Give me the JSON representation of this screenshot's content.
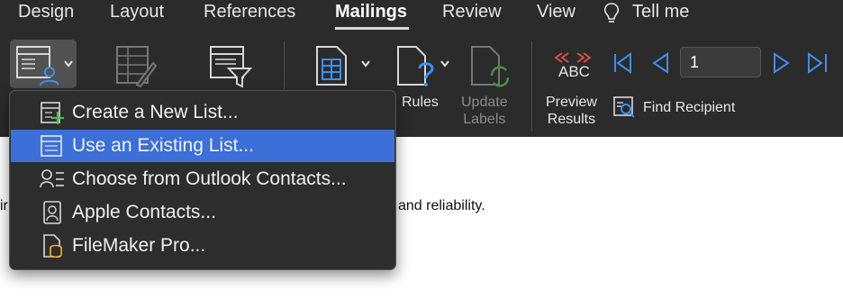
{
  "ribbon_tabs": [
    {
      "label": "Design"
    },
    {
      "label": "Layout"
    },
    {
      "label": "References"
    },
    {
      "label": "Mailings",
      "active": true
    },
    {
      "label": "Review"
    },
    {
      "label": "View"
    }
  ],
  "tell_me": {
    "label": "Tell me",
    "icon": "lightbulb-icon"
  },
  "ribbon": {
    "rules_label": "Rules",
    "update_labels_line1": "Update",
    "update_labels_line2": "Labels",
    "preview_results_line1": "Preview",
    "preview_results_line2": "Results",
    "preview_icon_text": "ABC",
    "find_recipient": "Find Recipient",
    "record_number": "1"
  },
  "document": {
    "text_fragment_left": "ir",
    "text_fragment_right": "and reliability."
  },
  "menu": {
    "items": [
      {
        "label": "Create a New List...",
        "icon": "new-list-icon"
      },
      {
        "label": "Use an Existing List...",
        "icon": "existing-list-icon",
        "highlighted": true
      },
      {
        "label": "Choose from Outlook Contacts...",
        "icon": "outlook-contacts-icon"
      },
      {
        "label": "Apple Contacts...",
        "icon": "apple-contacts-icon"
      },
      {
        "label": "FileMaker Pro...",
        "icon": "filemaker-icon"
      }
    ]
  },
  "colors": {
    "ribbon_bg": "#2b2b2b",
    "highlight": "#3c6fd8",
    "accent_blue": "#3f8ef0",
    "accent_red": "#e0524a"
  }
}
